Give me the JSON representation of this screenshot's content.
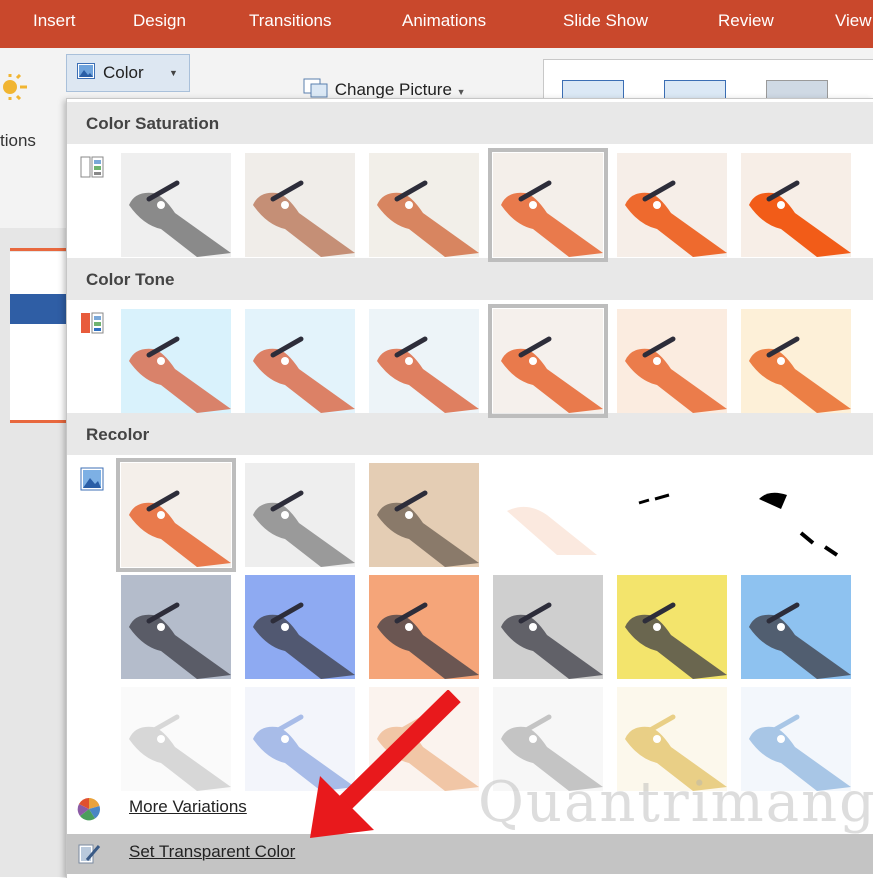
{
  "ribbon": {
    "tabs": [
      {
        "label": "Insert"
      },
      {
        "label": "Design"
      },
      {
        "label": "Transitions"
      },
      {
        "label": "Animations"
      },
      {
        "label": "Slide Show"
      },
      {
        "label": "Review"
      },
      {
        "label": "View"
      }
    ],
    "partial_group_label": "tions",
    "color_button": {
      "label": "Color",
      "icon": "picture-color-icon"
    },
    "change_picture": {
      "label": "Change Picture",
      "icon": "change-picture-icon"
    }
  },
  "dropdown": {
    "sections": [
      {
        "title": "Color Saturation",
        "icon": "color-saturation-icon",
        "swatches": [
          {
            "tint": "#efefef",
            "sat": 0.0
          },
          {
            "tint": "#f0ede9",
            "sat": 0.33
          },
          {
            "tint": "#f2efe9",
            "sat": 0.66
          },
          {
            "tint": "#f4efea",
            "sat": 1.0,
            "selected": true
          },
          {
            "tint": "#f6eee8",
            "sat": 1.5
          },
          {
            "tint": "#f7eee7",
            "sat": 2.0
          }
        ]
      },
      {
        "title": "Color Tone",
        "icon": "color-tone-icon",
        "swatches": [
          {
            "tint": "#d9f2fc"
          },
          {
            "tint": "#e3f3fb"
          },
          {
            "tint": "#edf4f8",
            "selected": false
          },
          {
            "tint": "#f5f0ec",
            "selected": true
          },
          {
            "tint": "#fbece0"
          },
          {
            "tint": "#fdf0d8"
          }
        ]
      },
      {
        "title": "Recolor",
        "icon": "recolor-icon",
        "rows": [
          [
            {
              "tint": "#f4efea",
              "style": "orig",
              "selected": true
            },
            {
              "tint": "#eeeeee",
              "style": "gray"
            },
            {
              "tint": "#e4cdb4",
              "style": "sepia"
            },
            {
              "tint": "#ffffff",
              "style": "washout"
            },
            {
              "tint": "#ffffff",
              "style": "bw1"
            },
            {
              "tint": "#ffffff",
              "style": "bw2"
            }
          ],
          [
            {
              "tint": "#b4bccb",
              "style": "dark"
            },
            {
              "tint": "#8eaaf2",
              "style": "dark"
            },
            {
              "tint": "#f5a579",
              "style": "dark"
            },
            {
              "tint": "#cfcfcf",
              "style": "dark"
            },
            {
              "tint": "#f3e46c",
              "style": "dark"
            },
            {
              "tint": "#8ec2f0",
              "style": "dark"
            }
          ],
          [
            {
              "tint": "#fafafa",
              "style": "light",
              "hand": "#d7d7d7"
            },
            {
              "tint": "#f3f5fb",
              "style": "light",
              "hand": "#a8bce8"
            },
            {
              "tint": "#fbf3ee",
              "style": "light",
              "hand": "#f1c6a6"
            },
            {
              "tint": "#f7f7f7",
              "style": "light",
              "hand": "#c4c4c4"
            },
            {
              "tint": "#fcf8ec",
              "style": "light",
              "hand": "#e9cf86"
            },
            {
              "tint": "#f3f7fc",
              "style": "light",
              "hand": "#a8c6e6"
            }
          ]
        ]
      }
    ],
    "more_variations": {
      "label": "More Variations",
      "icon": "color-wheel-icon"
    },
    "set_transparent": {
      "label": "Set Transparent Color",
      "icon": "pen-transparent-icon"
    }
  },
  "watermark": "Quantrimang",
  "colors": {
    "accent": "#c9482c",
    "arrow": "#e8191c",
    "hand": "#e97a4c"
  }
}
